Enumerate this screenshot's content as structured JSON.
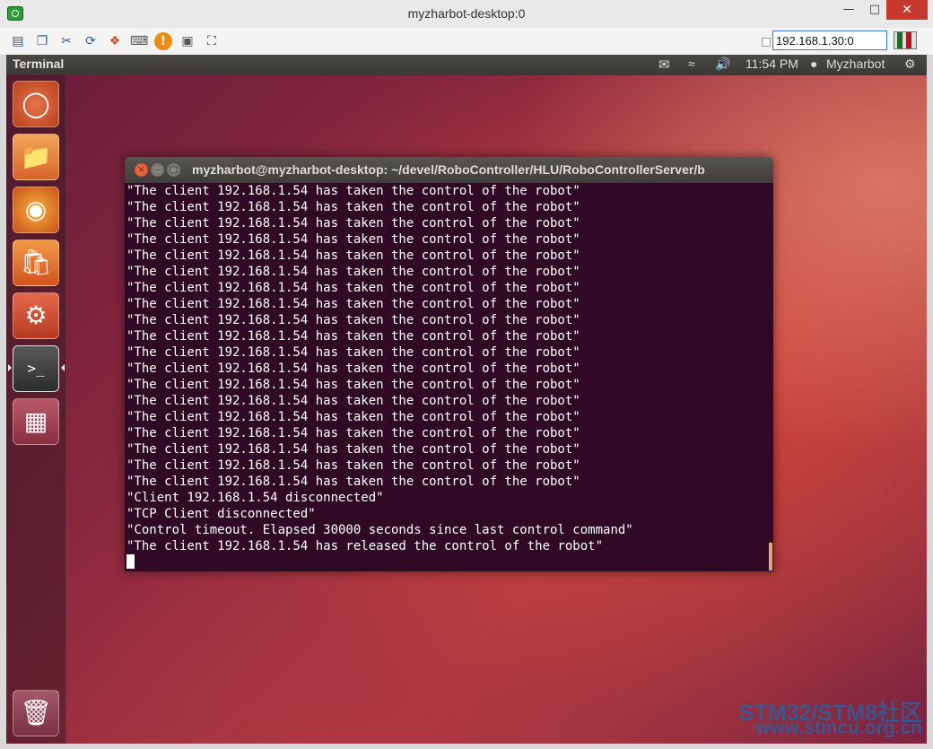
{
  "window": {
    "title": "myzharbot-desktop:0"
  },
  "toolbar": {
    "icons": [
      "monitor-icon",
      "copy-icon",
      "tools-icon",
      "refresh-icon",
      "windows-icon",
      "keyboard-icon",
      "alert-icon",
      "disconnect-icon",
      "fullscreen-icon"
    ],
    "address": "192.168.1.30:0"
  },
  "panel": {
    "app_name": "Terminal",
    "time": "11:54 PM",
    "user": "Myzharbot"
  },
  "terminal": {
    "title": "myzharbot@myzharbot-desktop: ~/devel/RoboController/HLU/RoboControllerServer/b",
    "lines": [
      "\"The client 192.168.1.54 has taken the control of the robot\"",
      "\"The client 192.168.1.54 has taken the control of the robot\"",
      "\"The client 192.168.1.54 has taken the control of the robot\"",
      "\"The client 192.168.1.54 has taken the control of the robot\"",
      "\"The client 192.168.1.54 has taken the control of the robot\"",
      "\"The client 192.168.1.54 has taken the control of the robot\"",
      "\"The client 192.168.1.54 has taken the control of the robot\"",
      "\"The client 192.168.1.54 has taken the control of the robot\"",
      "\"The client 192.168.1.54 has taken the control of the robot\"",
      "\"The client 192.168.1.54 has taken the control of the robot\"",
      "\"The client 192.168.1.54 has taken the control of the robot\"",
      "\"The client 192.168.1.54 has taken the control of the robot\"",
      "\"The client 192.168.1.54 has taken the control of the robot\"",
      "\"The client 192.168.1.54 has taken the control of the robot\"",
      "\"The client 192.168.1.54 has taken the control of the robot\"",
      "\"The client 192.168.1.54 has taken the control of the robot\"",
      "\"The client 192.168.1.54 has taken the control of the robot\"",
      "\"The client 192.168.1.54 has taken the control of the robot\"",
      "\"The client 192.168.1.54 has taken the control of the robot\"",
      "\"Client 192.168.1.54 disconnected\"",
      "\"TCP Client disconnected\"",
      "\"Control timeout. Elapsed 30000 seconds since last control command\"",
      "\"The client 192.168.1.54 has released the control of the robot\""
    ]
  },
  "watermark": {
    "line1": "STM32/STM8社区",
    "line2": "www.stmcu.org.cn"
  },
  "colors": {
    "terminal_bg": "#300a24",
    "panel_bg": "#3c3b37",
    "close": "#c7392f"
  }
}
